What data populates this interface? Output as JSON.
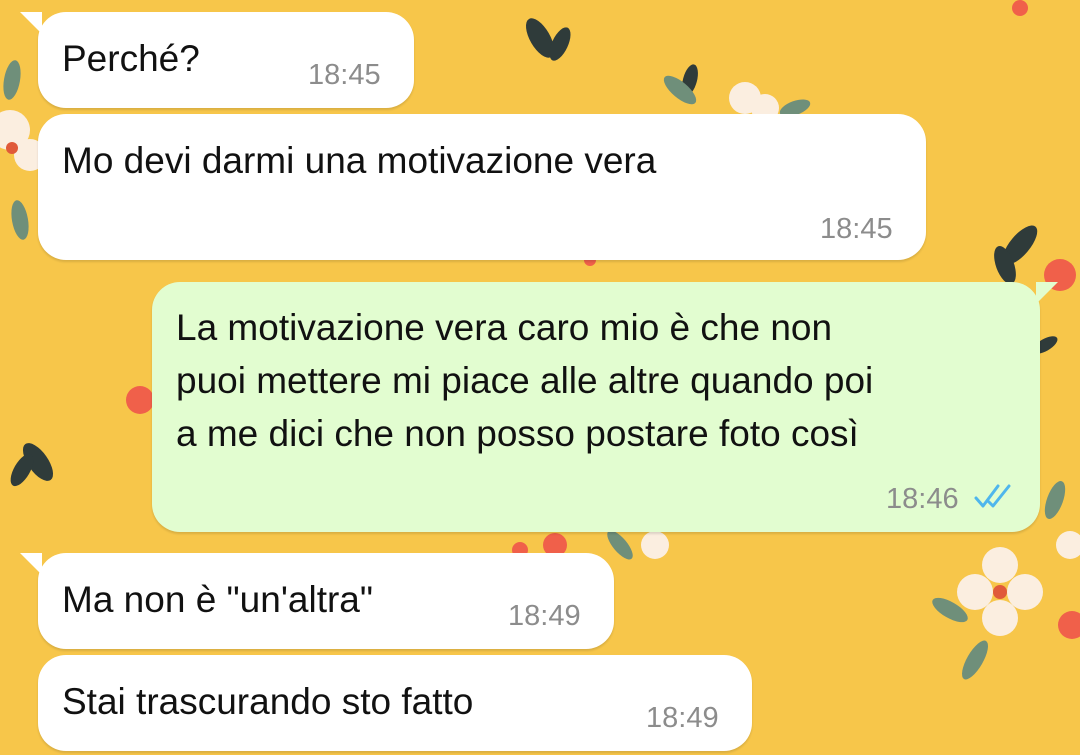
{
  "colors": {
    "wallpaper": "#f7c64a",
    "incoming_bubble": "#ffffff",
    "outgoing_bubble": "#e2fdd0",
    "timestamp": "#8c8c8c",
    "read_ticks": "#4fb6ec"
  },
  "messages": [
    {
      "direction": "incoming",
      "text": "Perché?",
      "time": "18:45"
    },
    {
      "direction": "incoming",
      "text": "Mo devi darmi una motivazione vera",
      "time": "18:45"
    },
    {
      "direction": "outgoing",
      "text": "La motivazione vera caro mio è che non\npuoi mettere mi piace alle altre quando poi\na me dici che non posso postare foto così",
      "time": "18:46",
      "status_icon": "double-check-read-icon"
    },
    {
      "direction": "incoming",
      "text": "Ma non è \"un'altra\"",
      "time": "18:49"
    },
    {
      "direction": "incoming",
      "text": "Stai trascurando sto fatto",
      "time": "18:49"
    }
  ]
}
